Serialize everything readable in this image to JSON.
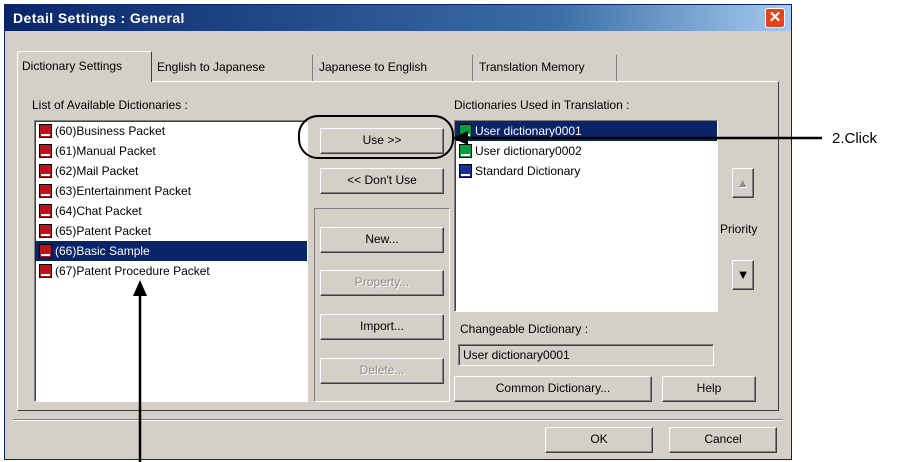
{
  "window": {
    "title": "Detail Settings : General",
    "close_glyph": "✕"
  },
  "tabs": [
    {
      "label": "Dictionary Settings",
      "active": true
    },
    {
      "label": "English to Japanese",
      "active": false
    },
    {
      "label": "Japanese to English",
      "active": false
    },
    {
      "label": "Translation Memory",
      "active": false
    }
  ],
  "available": {
    "heading": "List of Available Dictionaries :",
    "items": [
      {
        "label": "(60)Business Packet",
        "icon": "red-book-icon",
        "selected": false
      },
      {
        "label": "(61)Manual Packet",
        "icon": "red-book-icon",
        "selected": false
      },
      {
        "label": "(62)Mail Packet",
        "icon": "red-book-icon",
        "selected": false
      },
      {
        "label": "(63)Entertainment Packet",
        "icon": "red-book-icon",
        "selected": false
      },
      {
        "label": "(64)Chat Packet",
        "icon": "red-book-icon",
        "selected": false
      },
      {
        "label": "(65)Patent Packet",
        "icon": "red-book-icon",
        "selected": false
      },
      {
        "label": "(66)Basic Sample",
        "icon": "red-book-icon",
        "selected": true
      },
      {
        "label": "(67)Patent Procedure Packet",
        "icon": "red-book-icon",
        "selected": false
      }
    ]
  },
  "middle_buttons": {
    "use": "Use >>",
    "dont_use": "<< Don't Use",
    "new": "New...",
    "property": "Property...",
    "import": "Import...",
    "delete": "Delete..."
  },
  "used": {
    "heading": "Dictionaries Used in Translation :",
    "items": [
      {
        "label": "User dictionary0001",
        "icon": "green-book-icon",
        "selected": true
      },
      {
        "label": "User dictionary0002",
        "icon": "green-book-icon",
        "selected": false
      },
      {
        "label": "Standard Dictionary",
        "icon": "blue-book-icon",
        "selected": false
      }
    ]
  },
  "priority": {
    "label": "Priority",
    "up_glyph": "▲",
    "down_glyph": "▼"
  },
  "changeable": {
    "label": "Changeable Dictionary :",
    "value": "User dictionary0001"
  },
  "bottom_buttons": {
    "common": "Common Dictionary...",
    "help": "Help",
    "ok": "OK",
    "cancel": "Cancel"
  },
  "annotation": {
    "callout": "2.Click"
  },
  "colors": {
    "title_gradient_start": "#0a246a",
    "selection": "#0a246a",
    "face": "#d4d0c8",
    "close": "#e0451f"
  }
}
